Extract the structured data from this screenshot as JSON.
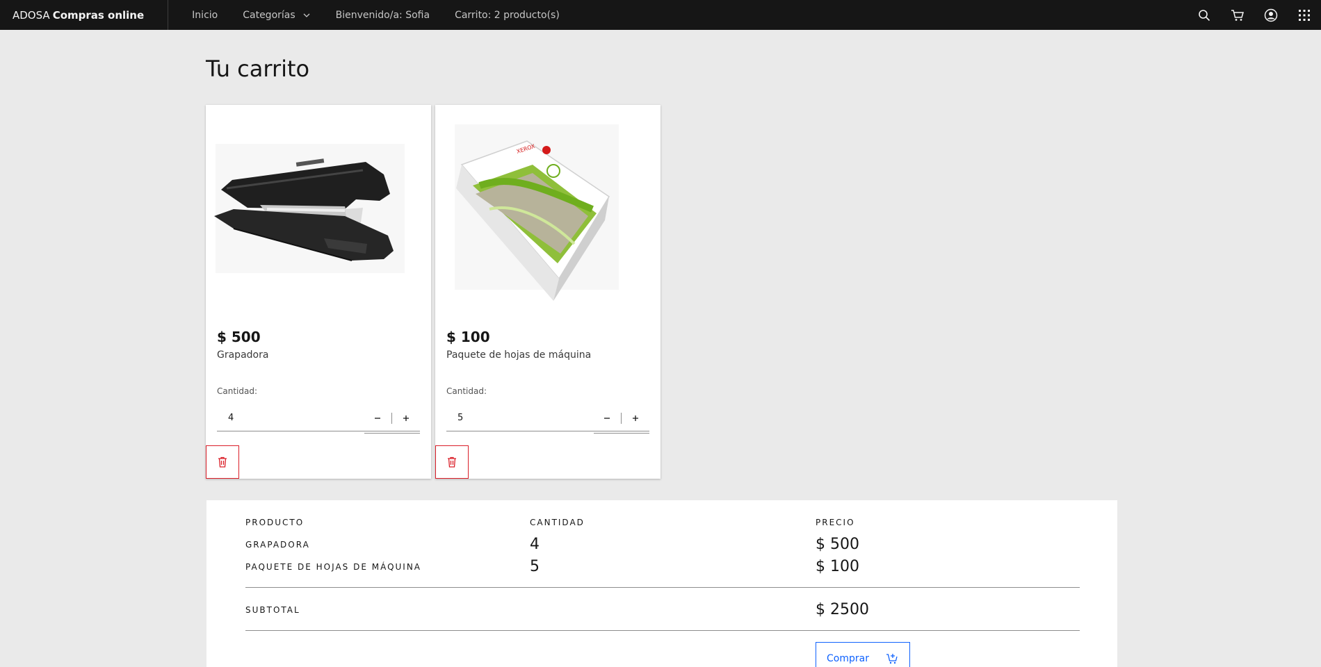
{
  "header": {
    "brand_prefix": "ADOSA",
    "brand_name": "Compras online",
    "nav": {
      "home": "Inicio",
      "categories": "Categorías",
      "welcome": "Bienvenido/a: Sofia",
      "cart": "Carrito: 2 producto(s)"
    }
  },
  "page": {
    "title": "Tu carrito"
  },
  "cart_items": [
    {
      "price": "$ 500",
      "name": "Grapadora",
      "qty_label": "Cantidad:",
      "qty": "4",
      "image": "stapler"
    },
    {
      "price": "$ 100",
      "name": "Paquete de hojas de máquina",
      "qty_label": "Cantidad:",
      "qty": "5",
      "image": "paper-ream"
    }
  ],
  "summary": {
    "headers": {
      "product": "PRODUCTO",
      "quantity": "CANTIDAD",
      "price": "PRECIO"
    },
    "rows": [
      {
        "product": "GRAPADORA",
        "quantity": "4",
        "price": "$ 500"
      },
      {
        "product": "PAQUETE DE HOJAS DE MÁQUINA",
        "quantity": "5",
        "price": "$ 100"
      }
    ],
    "subtotal_label": "SUBTOTAL",
    "subtotal_value": "$ 2500",
    "buy_label": "Comprar"
  },
  "colors": {
    "topbar": "#161616",
    "danger": "#da1e28",
    "primary": "#0f62fe",
    "background": "#eaeaea"
  }
}
